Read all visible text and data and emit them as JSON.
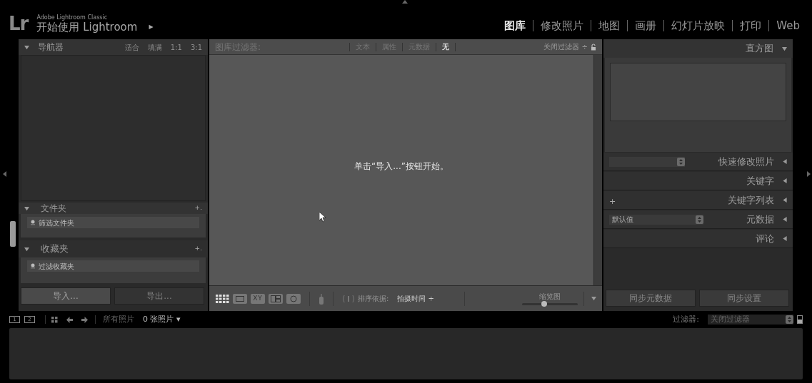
{
  "identity": {
    "logo": "Lr",
    "product": "Adobe Lightroom Classic",
    "title": "开始使用 Lightroom",
    "arrow": "▶"
  },
  "modules": [
    {
      "label": "图库",
      "selected": true
    },
    {
      "label": "修改照片",
      "selected": false
    },
    {
      "label": "地图",
      "selected": false
    },
    {
      "label": "画册",
      "selected": false
    },
    {
      "label": "幻灯片放映",
      "selected": false
    },
    {
      "label": "打印",
      "selected": false
    },
    {
      "label": "Web",
      "selected": false
    }
  ],
  "navigator": {
    "title": "导航器",
    "zoom_options": [
      "适合",
      "填满",
      "1:1",
      "3:1"
    ]
  },
  "folders": {
    "title": "文件夹",
    "add": "+.",
    "search_placeholder": "筛选文件夹"
  },
  "collections": {
    "title": "收藏夹",
    "add": "+.",
    "search_placeholder": "过滤收藏夹"
  },
  "left_buttons": [
    {
      "label": "导入...",
      "disabled": false
    },
    {
      "label": "导出...",
      "disabled": true
    }
  ],
  "filter_bar": {
    "title": "图库过滤器:",
    "tabs": [
      {
        "label": "文本",
        "selected": false
      },
      {
        "label": "属性",
        "selected": false
      },
      {
        "label": "元数据",
        "selected": false
      },
      {
        "label": "无",
        "selected": true
      }
    ],
    "preset": "关闭过滤器 ÷"
  },
  "message": "单击“导入...”按钮开始。",
  "toolbar": {
    "view_modes": [
      {
        "kind": "grid",
        "selected": true
      },
      {
        "kind": "loupe",
        "selected": false
      },
      {
        "kind": "compare",
        "label": "XY",
        "selected": false
      },
      {
        "kind": "survey",
        "selected": false
      },
      {
        "kind": "people",
        "selected": false
      }
    ],
    "sort_label": "排序依据:",
    "sort_value": "拍摄时间 ÷",
    "thumbnail_label": "缩览图",
    "thumbnail_slider": {
      "level": 0.4
    }
  },
  "right_panel": {
    "histogram_title": "直方图",
    "panels": [
      {
        "kind": "select",
        "title": "快速修改照片"
      },
      {
        "kind": "plain",
        "title": "关键字"
      },
      {
        "kind": "plus",
        "title": "关键字列表",
        "add": "+"
      },
      {
        "kind": "select",
        "title": "元数据",
        "value": "默认值"
      },
      {
        "kind": "plain",
        "title": "评论"
      }
    ],
    "buttons": [
      "同步元数据",
      "同步设置"
    ]
  },
  "filmstrip": {
    "screens": [
      "1",
      "2"
    ],
    "source": "所有照片",
    "count": "0 张照片 ▾",
    "filter_label": "过滤器:",
    "filter_value": "关闭过滤器"
  }
}
